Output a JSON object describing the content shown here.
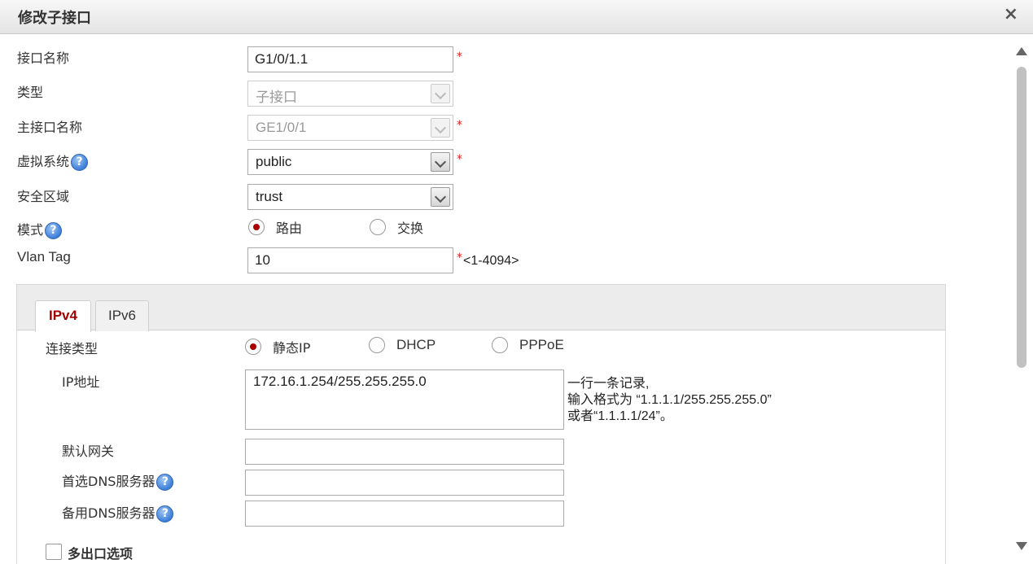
{
  "dialog": {
    "title": "修改子接口",
    "close_glyph": "×"
  },
  "form": {
    "interface_name": {
      "label": "接口名称",
      "value": "G1/0/1.1",
      "required": "*"
    },
    "type": {
      "label": "类型",
      "value": "子接口"
    },
    "parent_interface": {
      "label": "主接口名称",
      "value": "GE1/0/1",
      "required": "*"
    },
    "vsys": {
      "label": "虚拟系统",
      "value": "public",
      "required": "*"
    },
    "zone": {
      "label": "安全区域",
      "value": "trust"
    },
    "mode": {
      "label": "模式",
      "options": [
        "路由",
        "交换"
      ],
      "selected": "路由"
    },
    "vlan_tag": {
      "label": "Vlan Tag",
      "value": "10",
      "required": "*",
      "range": "<1-4094>"
    },
    "help_glyph": "?"
  },
  "tabs": [
    {
      "label": "IPv4",
      "active": true
    },
    {
      "label": "IPv6",
      "active": false
    }
  ],
  "ipv4": {
    "conn_type": {
      "label": "连接类型",
      "options": [
        "静态IP",
        "DHCP",
        "PPPoE"
      ],
      "selected": "静态IP"
    },
    "ip_address": {
      "label": "IP地址",
      "value": "172.16.1.254/255.255.255.0",
      "hint": [
        "一行一条记录,",
        "输入格式为 “1.1.1.1/255.255.255.0”",
        "或者“1.1.1.1/24”。"
      ]
    },
    "gateway": {
      "label": "默认网关",
      "value": ""
    },
    "dns_primary": {
      "label": "首选DNS服务器",
      "value": ""
    },
    "dns_secondary": {
      "label": "备用DNS服务器",
      "value": ""
    },
    "multi_egress": {
      "label": "多出口选项",
      "checked": false
    }
  }
}
